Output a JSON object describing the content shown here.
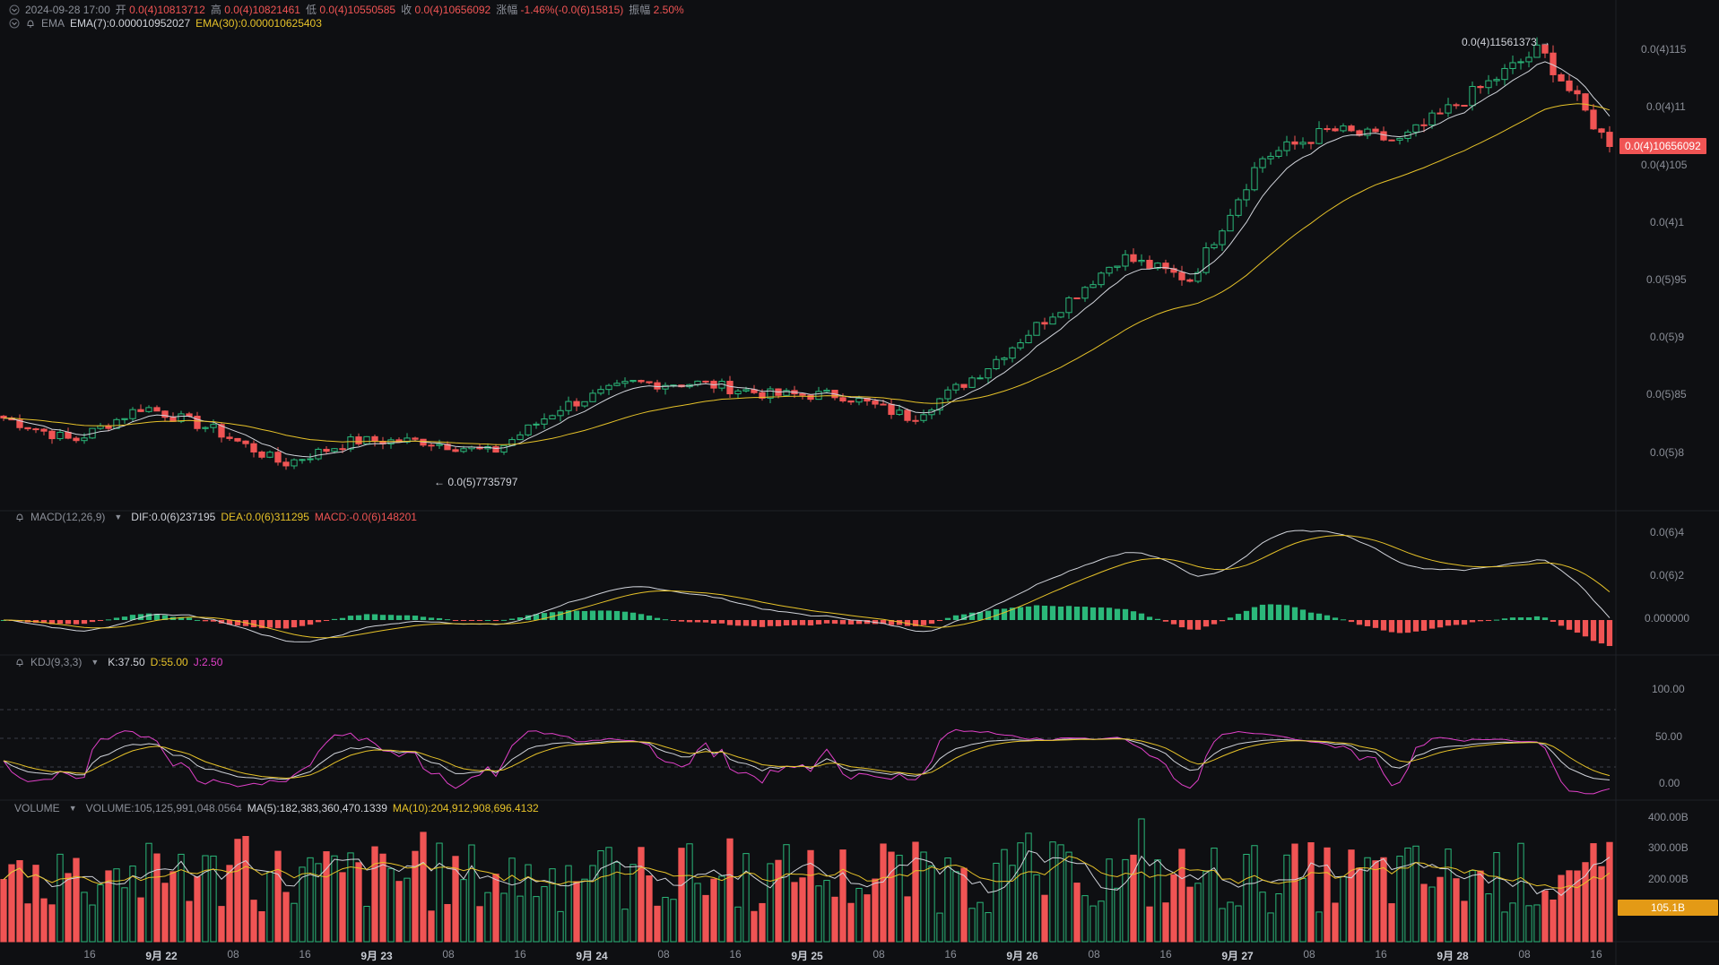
{
  "header": {
    "datetime": "2024-09-28 17:00",
    "open_label": "开",
    "open": "0.0(4)10813712",
    "high_label": "高",
    "high": "0.0(4)10821461",
    "low_label": "低",
    "low": "0.0(4)10550585",
    "close_label": "收",
    "close": "0.0(4)10656092",
    "change_label": "涨幅",
    "change": "-1.46%(-0.0(6)15815)",
    "amplitude_label": "振幅",
    "amplitude": "2.50%"
  },
  "ema": {
    "name": "EMA",
    "ema7": "EMA(7):0.000010952027",
    "ema30": "EMA(30):0.000010625403"
  },
  "macd": {
    "name": "MACD(12,26,9)",
    "dif": "DIF:0.0(6)237195",
    "dea": "DEA:0.0(6)311295",
    "macd": "MACD:-0.0(6)148201",
    "axis": [
      "0.0(6)4",
      "0.0(6)2",
      "0.000000"
    ]
  },
  "kdj": {
    "name": "KDJ(9,3,3)",
    "k": "K:37.50",
    "d": "D:55.00",
    "j": "J:2.50",
    "axis": [
      "100.00",
      "50.00",
      "0.00"
    ]
  },
  "volume": {
    "name": "VOLUME",
    "vol": "VOLUME:105,125,991,048.0564",
    "ma5": "MA(5):182,383,360,470.1339",
    "ma10": "MA(10):204,912,908,696.4132",
    "axis": [
      "400.00B",
      "300.00B",
      "200.00B"
    ],
    "current_tag": "105.1B"
  },
  "price_axis": [
    "0.0(4)115",
    "0.0(4)11",
    "0.0(4)105",
    "0.0(4)1",
    "0.0(5)95",
    "0.0(5)9",
    "0.0(5)85",
    "0.0(5)8"
  ],
  "price_tag": "0.0(4)10656092",
  "annotations": {
    "high_marker": "0.0(4)11561373 →",
    "low_marker": "← 0.0(5)7735797"
  },
  "x_axis": [
    {
      "label": "16",
      "bold": false
    },
    {
      "label": "9月 22",
      "bold": true
    },
    {
      "label": "08",
      "bold": false
    },
    {
      "label": "16",
      "bold": false
    },
    {
      "label": "9月 23",
      "bold": true
    },
    {
      "label": "08",
      "bold": false
    },
    {
      "label": "16",
      "bold": false
    },
    {
      "label": "9月 24",
      "bold": true
    },
    {
      "label": "08",
      "bold": false
    },
    {
      "label": "16",
      "bold": false
    },
    {
      "label": "9月 25",
      "bold": true
    },
    {
      "label": "08",
      "bold": false
    },
    {
      "label": "16",
      "bold": false
    },
    {
      "label": "9月 26",
      "bold": true
    },
    {
      "label": "08",
      "bold": false
    },
    {
      "label": "16",
      "bold": false
    },
    {
      "label": "9月 27",
      "bold": true
    },
    {
      "label": "08",
      "bold": false
    },
    {
      "label": "16",
      "bold": false
    },
    {
      "label": "9月 28",
      "bold": true
    },
    {
      "label": "08",
      "bold": false
    },
    {
      "label": "16",
      "bold": false
    }
  ],
  "colors": {
    "up": "#2bb87a",
    "down": "#f05454",
    "ema7": "#d0d3da",
    "ema30": "#e6c229",
    "kdj_j": "#e040c8",
    "volume_tag": "#e39a16"
  },
  "chart_data": {
    "type": "candlestick",
    "price_waypoints": [
      8.3e-06,
      8.1e-06,
      8.4e-06,
      8.2e-06,
      7.9e-06,
      8.1e-06,
      8.1e-06,
      8e-06,
      8.4e-06,
      8.6e-06,
      8.6e-06,
      8.5e-06,
      8.5e-06,
      8.3e-06,
      8.7e-06,
      9.2e-06,
      9.7e-06,
      9.5e-06,
      1.055e-05,
      1.08e-05,
      1.07e-05,
      1.11e-05,
      1.15e-05,
      1.066e-05
    ],
    "current_close": 1.0656092e-05,
    "period_high": 1.1561373e-05,
    "period_low": 7.735797e-06
  }
}
